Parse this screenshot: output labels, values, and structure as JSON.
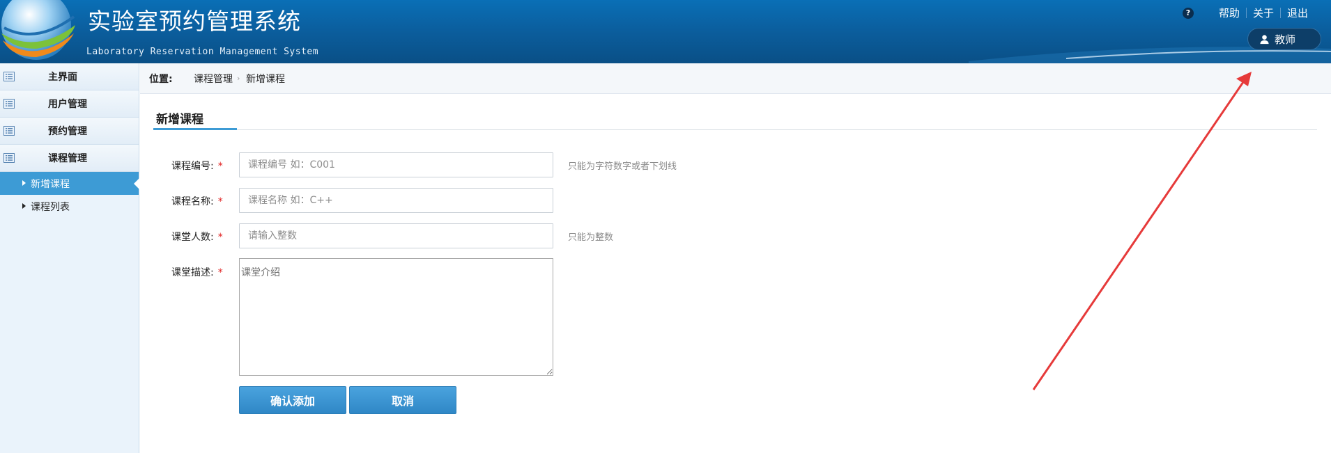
{
  "header": {
    "title": "实验室预约管理系统",
    "subtitle": "Laboratory Reservation Management System",
    "links": {
      "help": "帮助",
      "about": "关于",
      "logout": "退出"
    },
    "help_glyph": "?",
    "user_role": "教师"
  },
  "sidebar": {
    "groups": [
      {
        "label": "主界面",
        "icon": "list-icon"
      },
      {
        "label": "用户管理",
        "icon": "list-icon"
      },
      {
        "label": "预约管理",
        "icon": "list-icon"
      },
      {
        "label": "课程管理",
        "icon": "list-icon"
      }
    ],
    "subitems": [
      {
        "label": "新增课程",
        "active": true
      },
      {
        "label": "课程列表",
        "active": false
      }
    ]
  },
  "breadcrumb": {
    "prefix": "位置:",
    "items": [
      "课程管理",
      "新增课程"
    ],
    "separator": "›"
  },
  "form": {
    "section_title": "新增课程",
    "fields": [
      {
        "label": "课程编号:",
        "required_mark": "*",
        "placeholder": "课程编号 如：C001",
        "hint": "只能为字符数字或者下划线"
      },
      {
        "label": "课程名称:",
        "required_mark": "*",
        "placeholder": "课程名称 如：C++",
        "hint": ""
      },
      {
        "label": "课堂人数:",
        "required_mark": "*",
        "placeholder": "请输入整数",
        "hint": "只能为整数"
      },
      {
        "label": "课堂描述:",
        "required_mark": "*",
        "placeholder": "课堂介绍"
      }
    ],
    "buttons": {
      "confirm": "确认添加",
      "cancel": "取消"
    }
  },
  "colors": {
    "header_blue": "#0b5f9f",
    "accent_blue": "#3d9bd5",
    "required_red": "#e02020",
    "annotation_arrow": "#e63a3a"
  }
}
